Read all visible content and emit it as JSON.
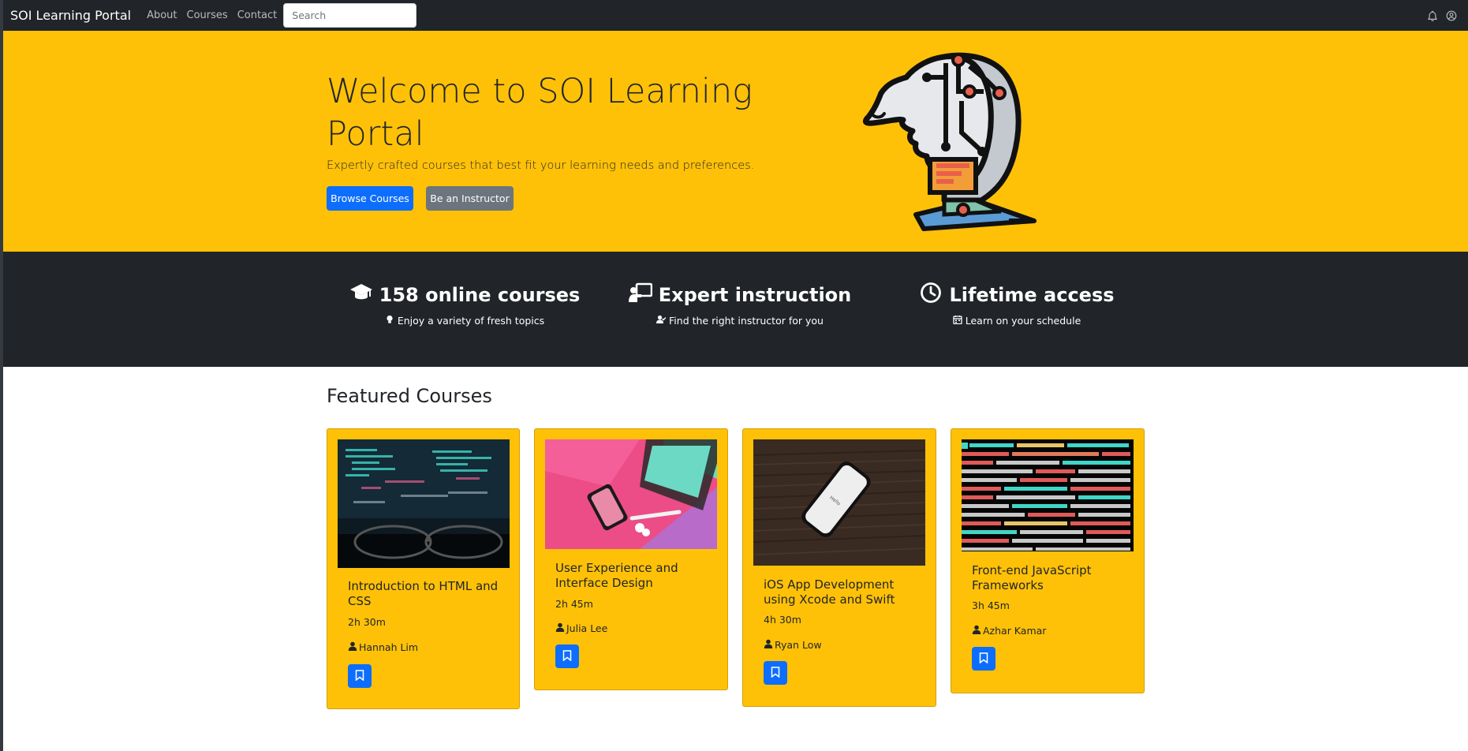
{
  "navbar": {
    "brand": "SOI Learning Portal",
    "links": [
      "About",
      "Courses",
      "Contact"
    ],
    "search_placeholder": "Search",
    "icons": [
      "bell-icon",
      "user-circle-icon"
    ]
  },
  "hero": {
    "title": "Welcome to SOI Learning Portal",
    "subtitle": "Expertly crafted courses that best fit your learning needs and preferences.",
    "primary_button": "Browse Courses",
    "secondary_button": "Be an Instructor"
  },
  "features": [
    {
      "icon": "graduation-cap-icon",
      "title": "158 online courses",
      "sub_icon": "lightbulb-icon",
      "subtitle": "Enjoy a variety of fresh topics"
    },
    {
      "icon": "chalkboard-teacher-icon",
      "title": "Expert instruction",
      "sub_icon": "user-check-icon",
      "subtitle": "Find the right instructor for you"
    },
    {
      "icon": "clock-icon",
      "title": "Lifetime access",
      "sub_icon": "calendar-icon",
      "subtitle": "Learn on your schedule"
    }
  ],
  "featured": {
    "heading": "Featured Courses",
    "courses": [
      {
        "title": "Introduction to HTML and CSS",
        "duration": "2h 30m",
        "instructor": "Hannah Lim",
        "image": "code-screen-glasses"
      },
      {
        "title": "User Experience and Interface Design",
        "duration": "2h 45m",
        "instructor": "Julia Lee",
        "image": "phone-tablet-pink"
      },
      {
        "title": "iOS App Development using Xcode and Swift",
        "duration": "4h 30m",
        "instructor": "Ryan Low",
        "image": "iphone-wood"
      },
      {
        "title": "Front-end JavaScript Frameworks",
        "duration": "3h 45m",
        "instructor": "Azhar Kamar",
        "image": "javascript-code"
      }
    ]
  },
  "colors": {
    "accent": "#ffc107",
    "dark": "#212529",
    "primary": "#0d6efd",
    "secondary": "#6c757d"
  }
}
